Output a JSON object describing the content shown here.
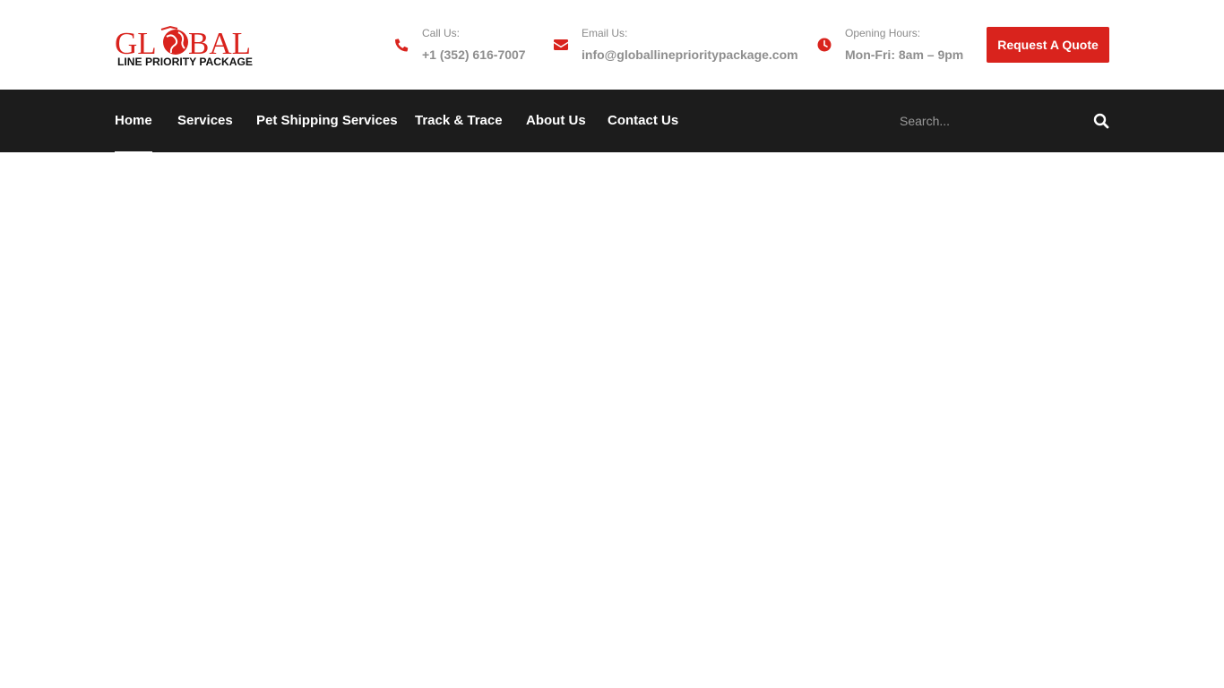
{
  "brand": {
    "logo_word": "GLOBAL",
    "logo_tagline": "LINE PRIORITY PACKAGE",
    "accent_color": "#d9231d"
  },
  "contact": {
    "call_label": "Call Us:",
    "call_value": "+1 (352) 616-7007",
    "email_label": "Email Us:",
    "email_value": "info@globallineprioritypackage.com",
    "hours_label": "Opening Hours:",
    "hours_value": "Mon-Fri: 8am – 9pm"
  },
  "cta": {
    "quote_label": "Request A Quote"
  },
  "nav": {
    "items": [
      {
        "label": "Home",
        "active": true
      },
      {
        "label": "Services",
        "active": false
      },
      {
        "label": "Pet Shipping Services",
        "active": false
      },
      {
        "label": "Track & Trace",
        "active": false
      },
      {
        "label": "About Us",
        "active": false
      },
      {
        "label": "Contact Us",
        "active": false
      }
    ],
    "background": "#1c1c1c"
  },
  "search": {
    "placeholder": "Search...",
    "icon": "search-icon"
  },
  "icons": {
    "call": "phone-icon",
    "email": "envelope-icon",
    "hours": "clock-icon"
  }
}
